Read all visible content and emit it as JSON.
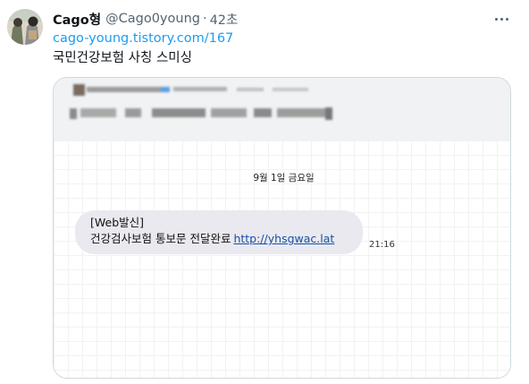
{
  "tweet": {
    "display_name": "Cago형",
    "handle": "@Cago0young",
    "separator": "·",
    "timestamp": "42초",
    "link_text": "cago-young.tistory.com/167",
    "text": "국민건강보험 사칭 스미싱"
  },
  "card": {
    "date_divider": "9월 1일 금요일",
    "message": {
      "line1": "[Web발신]",
      "line2": "건강검사보험 통보문 전달완료",
      "link": "http://yhsgwac.lat",
      "time": "21:16"
    }
  },
  "colors": {
    "link_blue": "#1d9bf0",
    "text_primary": "#0f1419",
    "text_secondary": "#536471",
    "bubble_bg": "#e9e9ef",
    "message_link": "#1a4fa3"
  },
  "icons": {
    "more": "more-dots-icon"
  }
}
